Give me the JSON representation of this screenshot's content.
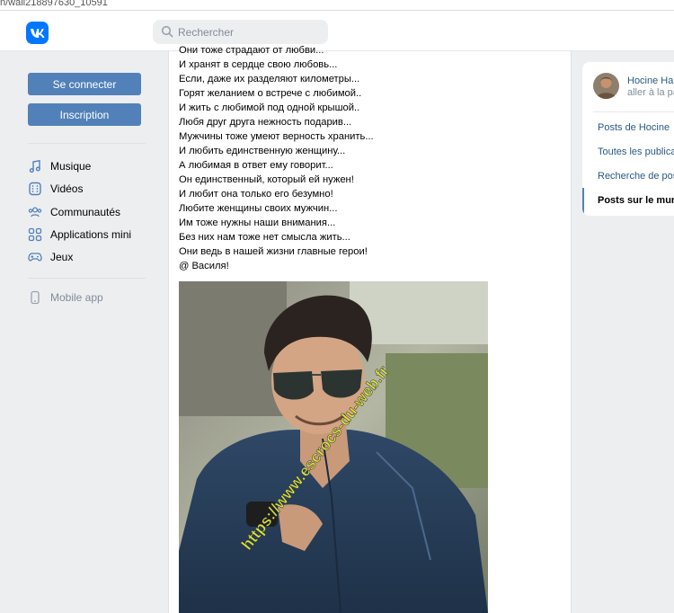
{
  "browser": {
    "url_fragment": "n/wall218897630_10591"
  },
  "header": {
    "search_placeholder": "Rechercher"
  },
  "auth": {
    "login_label": "Se connecter",
    "signup_label": "Inscription"
  },
  "sidebar": {
    "items": [
      {
        "label": "Musique",
        "icon": "music-icon"
      },
      {
        "label": "Vidéos",
        "icon": "video-icon"
      },
      {
        "label": "Communautés",
        "icon": "communities-icon"
      },
      {
        "label": "Applications mini",
        "icon": "apps-icon"
      },
      {
        "label": "Jeux",
        "icon": "gamepad-icon"
      }
    ],
    "mobile_app": "Mobile app"
  },
  "post": {
    "lines": [
      "Они тоже страдают от любви...",
      "И хранят в сердце свою любовь...",
      "Если, даже их разделяют километры...",
      "Горят желанием о встрече с любимой..",
      "И жить с любимой под одной крышой..",
      "Любя друг друга нежность подарив...",
      "Мужчины тоже умеют верность хранить...",
      "И любить единственную женщину...",
      "А любимая в ответ ему говорит...",
      "Он единственный, который ей нужен!",
      "И любит она только его безумно!",
      "Любите женщины своих мужчин...",
      "Им тоже нужны наши внимания...",
      "Без них нам тоже нет смысла жить...",
      "Они ведь в нашей жизни главные герои!",
      "@ Василя!"
    ],
    "watermark": "https://www.escrocs-du-web.fr"
  },
  "profile_panel": {
    "name": "Hocine Hamdani",
    "subtitle": "aller à la page",
    "links": [
      "Posts de Hocine",
      "Toutes les publications",
      "Recherche de posts",
      "Posts sur le mur"
    ]
  },
  "colors": {
    "brand": "#0077ff",
    "button": "#5181b8",
    "link": "#2a5885",
    "muted": "#818c99"
  }
}
